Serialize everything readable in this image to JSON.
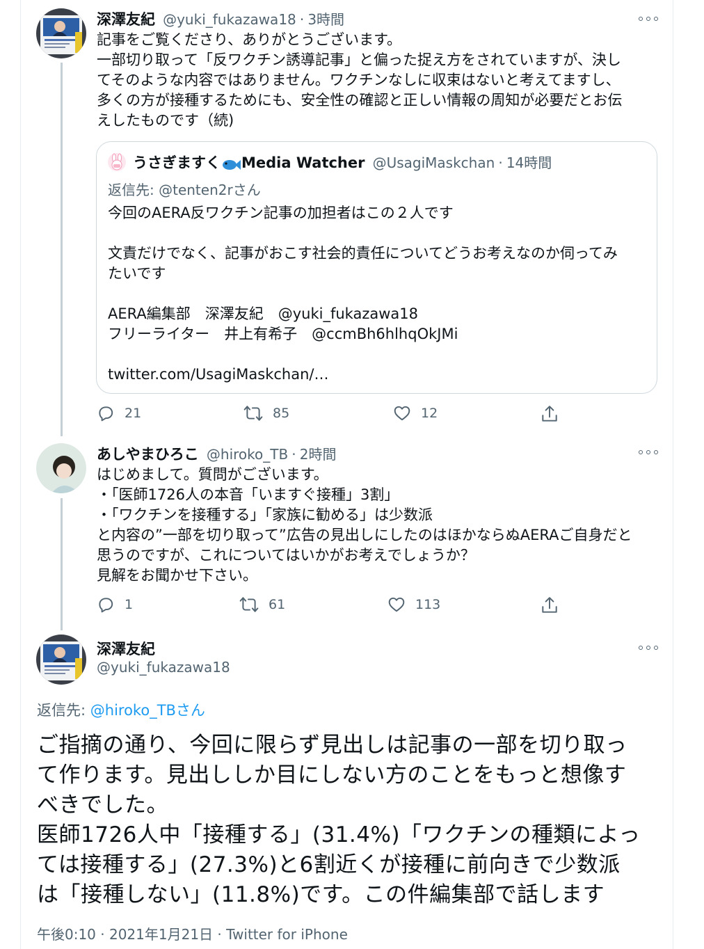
{
  "tweet1": {
    "name": "深澤友紀",
    "handle": "@yuki_fukazawa18",
    "separator": "·",
    "time": "3時間",
    "text": "記事をご覧くださり、ありがとうございます。\n一部切り取って「反ワクチン誘導記事」と偏った捉え方をされていますが、決し\nてそのような内容ではありません。ワクチンなしに収束はないと考えてますし、\n多くの方が接種するためにも、安全性の確認と正しい情報の周知が必要だとお伝\nえしたものです（続)",
    "quote": {
      "name": "うさぎますく",
      "name_suffix": "Media Watcher",
      "handle": "@UsagiMaskchan",
      "separator": "·",
      "time": "14時間",
      "reply_to_prefix": "返信先: ",
      "reply_to_handle": "@tenten2rさん",
      "text": "今回のAERA反ワクチン記事の加担者はこの２人です\n\n文責だけでなく、記事がおこす社会的責任についてどうお考えなのか伺ってみ\nたいです\n\nAERA編集部　深澤友紀　@yuki_fukazawa18\nフリーライター　井上有希子　@ccmBh6hlhqOkJMi\n\ntwitter.com/UsagiMaskchan/…"
    },
    "actions": {
      "replies": "21",
      "retweets": "85",
      "likes": "12"
    }
  },
  "tweet2": {
    "name": "あしやまひろこ",
    "handle": "@hiroko_TB",
    "separator": "·",
    "time": "2時間",
    "text": "はじめまして。質問がございます。\n・「医師1726人の本音「いますぐ接種」3割」\n・「ワクチンを接種する」「家族に勧める」は少数派\nと内容の”一部を切り取って”広告の見出しにしたのはほかならぬAERAご自身だと\n思うのですが、これについてはいかがお考えでしょうか？\n見解をお聞かせ下さい。",
    "actions": {
      "replies": "1",
      "retweets": "61",
      "likes": "113"
    }
  },
  "main_tweet": {
    "name": "深澤友紀",
    "handle": "@yuki_fukazawa18",
    "reply_to_prefix": "返信先: ",
    "reply_to_handle": "@hiroko_TBさん",
    "text": "ご指摘の通り、今回に限らず見出しは記事の一部を切り取っ\nて作ります。見出ししか目にしない方のことをもっと想像す\nべきでした。\n医師1726人中「接種する」(31.4%)「ワクチンの種類によっ\nては接種する」(27.3%)と6割近くが接種に前向きで少数派\nは「接種しない」(11.8%)です。この件編集部で話します",
    "timestamp": "午後0:10 · 2021年1月21日 · Twitter for iPhone"
  },
  "colors": {
    "accent": "#1d9bf0",
    "secondary_text": "#536471",
    "border": "#cfd9de"
  }
}
